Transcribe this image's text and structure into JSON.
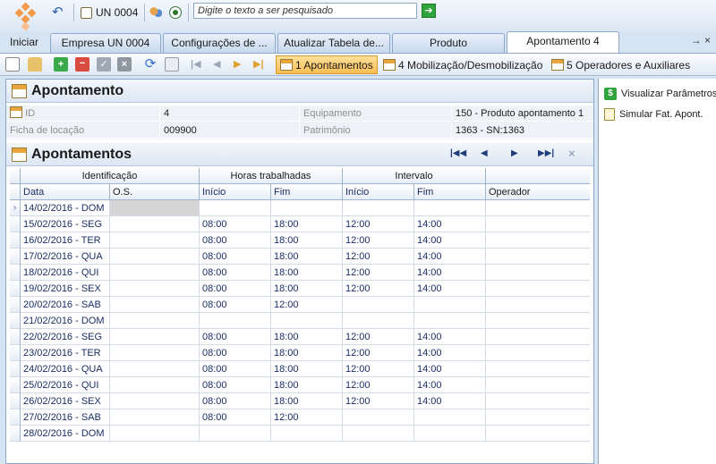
{
  "toolbar": {
    "unit_label": "UN 0004",
    "search_placeholder": "Digite o texto a ser pesquisado",
    "start_label": "Iniciar"
  },
  "tabs": [
    {
      "label": "Empresa UN 0004"
    },
    {
      "label": "Configurações de ..."
    },
    {
      "label": "Atualizar Tabela de..."
    },
    {
      "label": "Produto"
    },
    {
      "label": "Apontamento 4"
    }
  ],
  "tab_controls": "→ ×",
  "action_tabs": [
    {
      "label": "1 Apontamentos"
    },
    {
      "label": "4 Mobilização/Desmobilização"
    },
    {
      "label": "5 Operadores e Auxiliares"
    }
  ],
  "section": {
    "title": "Apontamento",
    "fields": {
      "id_label": "ID",
      "id_value": "4",
      "ficha_label": "Ficha de locação",
      "ficha_value": "009900",
      "equip_label": "Equipamento",
      "equip_value": "150 - Produto apontamento 1",
      "patrimonio_label": "Patrimônio",
      "patrimonio_value": "1363 - SN:1363"
    }
  },
  "grid_section": {
    "title": "Apontamentos",
    "bands": {
      "identificacao": "Identificação",
      "horas": "Horas trabalhadas",
      "intervalo": "Intervalo"
    },
    "columns": {
      "data": "Data",
      "os": "O.S.",
      "h_inicio": "Início",
      "h_fim": "Fim",
      "i_inicio": "Início",
      "i_fim": "Fim",
      "operador": "Operador"
    },
    "rows": [
      {
        "data": "14/02/2016 - DOM",
        "os": "",
        "hi": "",
        "hf": "",
        "ii": "",
        "if": "",
        "op": ""
      },
      {
        "data": "15/02/2016 - SEG",
        "os": "",
        "hi": "08:00",
        "hf": "18:00",
        "ii": "12:00",
        "if": "14:00",
        "op": ""
      },
      {
        "data": "16/02/2016 - TER",
        "os": "",
        "hi": "08:00",
        "hf": "18:00",
        "ii": "12:00",
        "if": "14:00",
        "op": ""
      },
      {
        "data": "17/02/2016 - QUA",
        "os": "",
        "hi": "08:00",
        "hf": "18:00",
        "ii": "12:00",
        "if": "14:00",
        "op": ""
      },
      {
        "data": "18/02/2016 - QUI",
        "os": "",
        "hi": "08:00",
        "hf": "18:00",
        "ii": "12:00",
        "if": "14:00",
        "op": ""
      },
      {
        "data": "19/02/2016 - SEX",
        "os": "",
        "hi": "08:00",
        "hf": "18:00",
        "ii": "12:00",
        "if": "14:00",
        "op": ""
      },
      {
        "data": "20/02/2016 - SAB",
        "os": "",
        "hi": "08:00",
        "hf": "12:00",
        "ii": "",
        "if": "",
        "op": ""
      },
      {
        "data": "21/02/2016 - DOM",
        "os": "",
        "hi": "",
        "hf": "",
        "ii": "",
        "if": "",
        "op": ""
      },
      {
        "data": "22/02/2016 - SEG",
        "os": "",
        "hi": "08:00",
        "hf": "18:00",
        "ii": "12:00",
        "if": "14:00",
        "op": ""
      },
      {
        "data": "23/02/2016 - TER",
        "os": "",
        "hi": "08:00",
        "hf": "18:00",
        "ii": "12:00",
        "if": "14:00",
        "op": ""
      },
      {
        "data": "24/02/2016 - QUA",
        "os": "",
        "hi": "08:00",
        "hf": "18:00",
        "ii": "12:00",
        "if": "14:00",
        "op": ""
      },
      {
        "data": "25/02/2016 - QUI",
        "os": "",
        "hi": "08:00",
        "hf": "18:00",
        "ii": "12:00",
        "if": "14:00",
        "op": ""
      },
      {
        "data": "26/02/2016 - SEX",
        "os": "",
        "hi": "08:00",
        "hf": "18:00",
        "ii": "12:00",
        "if": "14:00",
        "op": ""
      },
      {
        "data": "27/02/2016 - SAB",
        "os": "",
        "hi": "08:00",
        "hf": "12:00",
        "ii": "",
        "if": "",
        "op": ""
      },
      {
        "data": "28/02/2016 - DOM",
        "os": "",
        "hi": "",
        "hf": "",
        "ii": "",
        "if": "",
        "op": ""
      }
    ]
  },
  "sidebar": {
    "items": [
      {
        "label": "Visualizar Parâmetros",
        "icon": "dollar-icon"
      },
      {
        "label": "Simular Fat. Apont.",
        "icon": "document-icon"
      }
    ]
  },
  "colors": {
    "accent_orange": "#f39a4b",
    "active_tab": "#f9bc52",
    "frame_blue": "#8da8cb"
  }
}
